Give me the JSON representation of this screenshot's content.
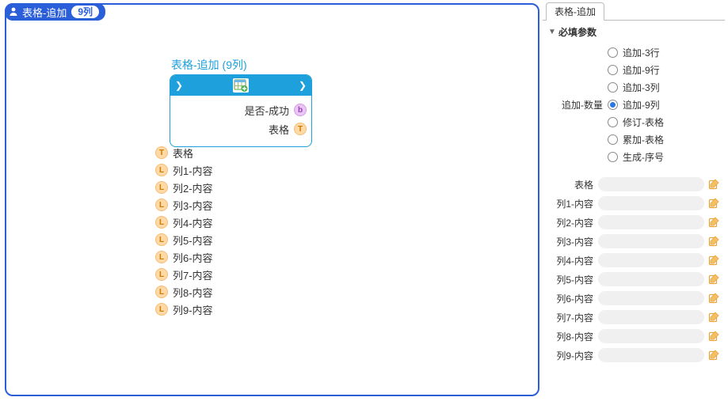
{
  "header": {
    "title": "表格-追加",
    "badge": "9列"
  },
  "block": {
    "title": "表格-追加 (9列)",
    "outputs": [
      {
        "label": "是否-成功",
        "type": "b"
      },
      {
        "label": "表格",
        "type": "T"
      }
    ],
    "inputs": [
      {
        "label": "表格",
        "type": "T"
      },
      {
        "label": "列1-内容",
        "type": "L"
      },
      {
        "label": "列2-内容",
        "type": "L"
      },
      {
        "label": "列3-内容",
        "type": "L"
      },
      {
        "label": "列4-内容",
        "type": "L"
      },
      {
        "label": "列5-内容",
        "type": "L"
      },
      {
        "label": "列6-内容",
        "type": "L"
      },
      {
        "label": "列7-内容",
        "type": "L"
      },
      {
        "label": "列8-内容",
        "type": "L"
      },
      {
        "label": "列9-内容",
        "type": "L"
      }
    ]
  },
  "side": {
    "tab": "表格-追加",
    "section": "必填参数",
    "radio_label": "追加-数量",
    "options": [
      {
        "text": "追加-3行",
        "selected": false
      },
      {
        "text": "追加-9行",
        "selected": false
      },
      {
        "text": "追加-3列",
        "selected": false
      },
      {
        "text": "追加-9列",
        "selected": true
      },
      {
        "text": "修订-表格",
        "selected": false
      },
      {
        "text": "累加-表格",
        "selected": false
      },
      {
        "text": "生成-序号",
        "selected": false
      }
    ],
    "params": [
      {
        "label": "表格"
      },
      {
        "label": "列1-内容"
      },
      {
        "label": "列2-内容"
      },
      {
        "label": "列3-内容"
      },
      {
        "label": "列4-内容"
      },
      {
        "label": "列5-内容"
      },
      {
        "label": "列6-内容"
      },
      {
        "label": "列7-内容"
      },
      {
        "label": "列8-内容"
      },
      {
        "label": "列9-内容"
      }
    ]
  }
}
